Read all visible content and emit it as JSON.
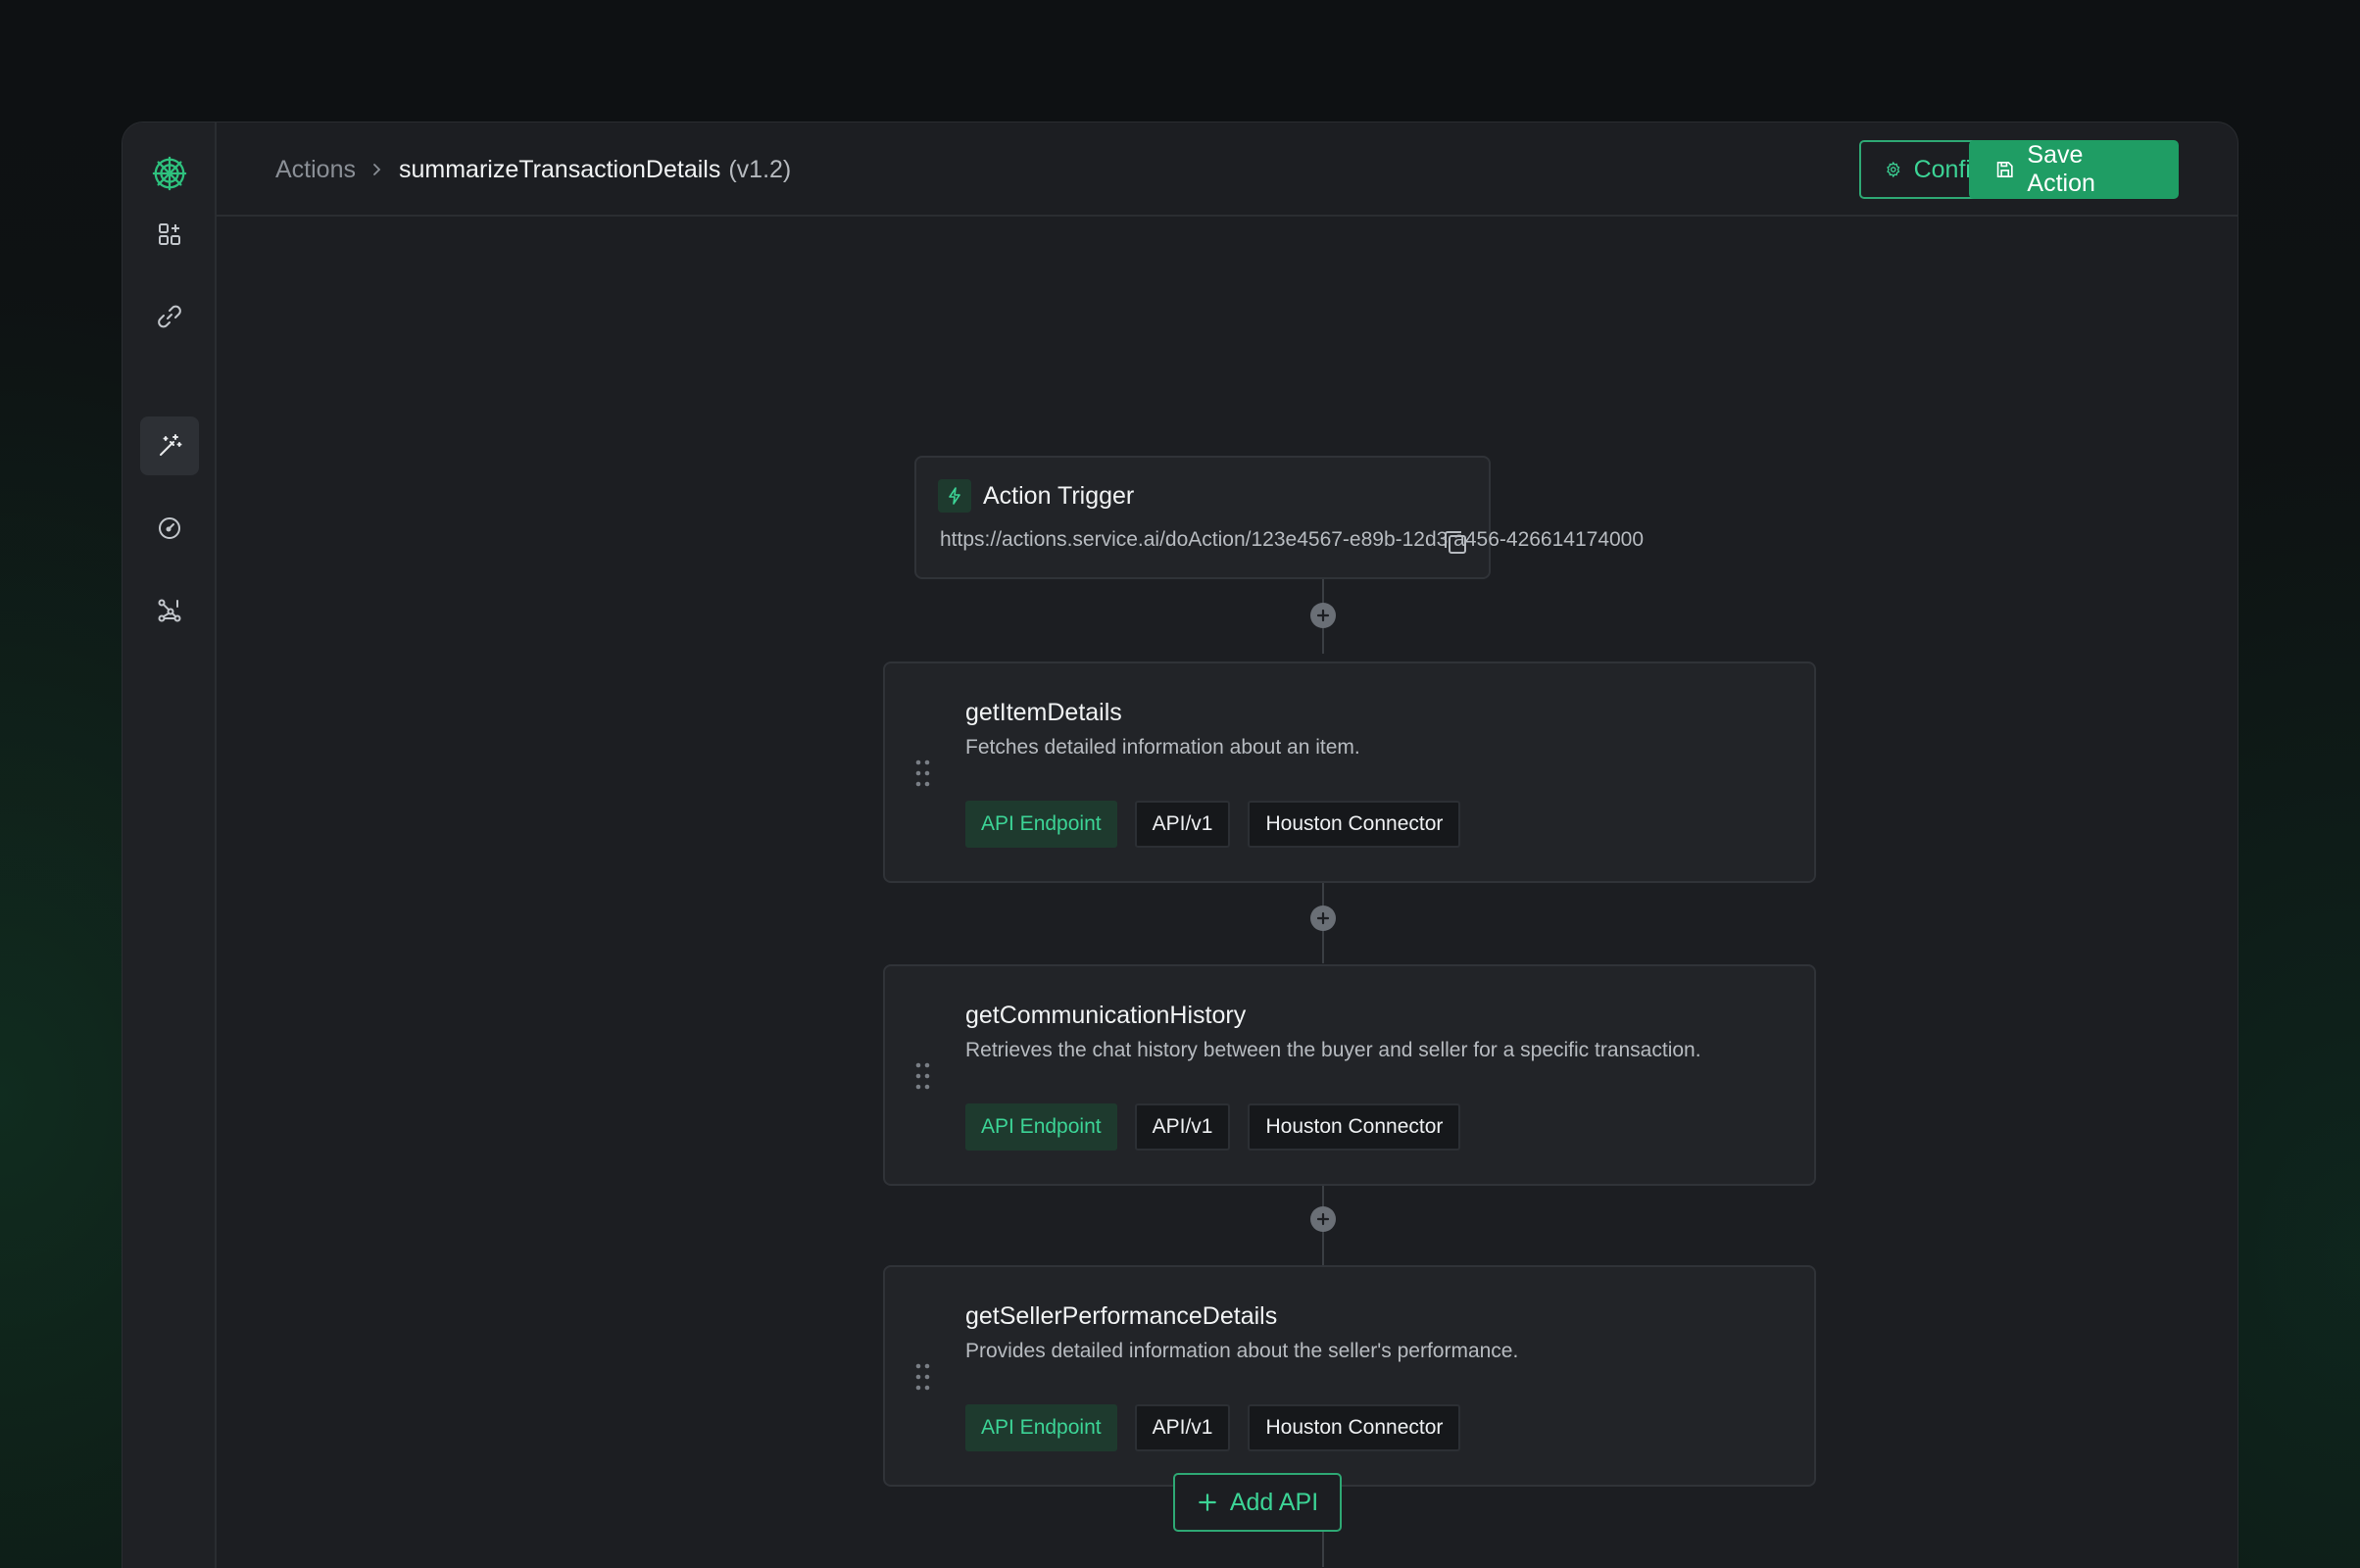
{
  "breadcrumb": {
    "root": "Actions",
    "current": "summarizeTransactionDetails",
    "version": "(v1.2)"
  },
  "header": {
    "configure_label": "Configure",
    "save_label": "Save Action"
  },
  "sidebar": {
    "items": [
      {
        "icon": "dashboard-add-icon",
        "active": false
      },
      {
        "icon": "link-icon",
        "active": false
      },
      {
        "icon": "magic-wand-icon",
        "active": true
      },
      {
        "icon": "gauge-icon",
        "active": false
      },
      {
        "icon": "network-icon",
        "active": false
      }
    ]
  },
  "trigger": {
    "title": "Action Trigger",
    "url": "https://actions.service.ai/doAction/123e4567-e89b-12d3 a456-426614174000"
  },
  "apis": [
    {
      "name": "getItemDetails",
      "description": "Fetches detailed information about an item.",
      "tags": [
        "API Endpoint",
        "API/v1",
        "Houston Connector"
      ]
    },
    {
      "name": "getCommunicationHistory",
      "description": "Retrieves the chat history between the buyer and seller for a specific transaction.",
      "tags": [
        "API Endpoint",
        "API/v1",
        "Houston Connector"
      ]
    },
    {
      "name": "getSellerPerformanceDetails",
      "description": "Provides detailed information about the seller's performance.",
      "tags": [
        "API Endpoint",
        "API/v1",
        "Houston Connector"
      ]
    }
  ],
  "add_api_label": "Add API",
  "colors": {
    "accent": "#1f9d64",
    "accent_text": "#3cd496",
    "panel": "#1c1e22",
    "card": "#222428"
  }
}
